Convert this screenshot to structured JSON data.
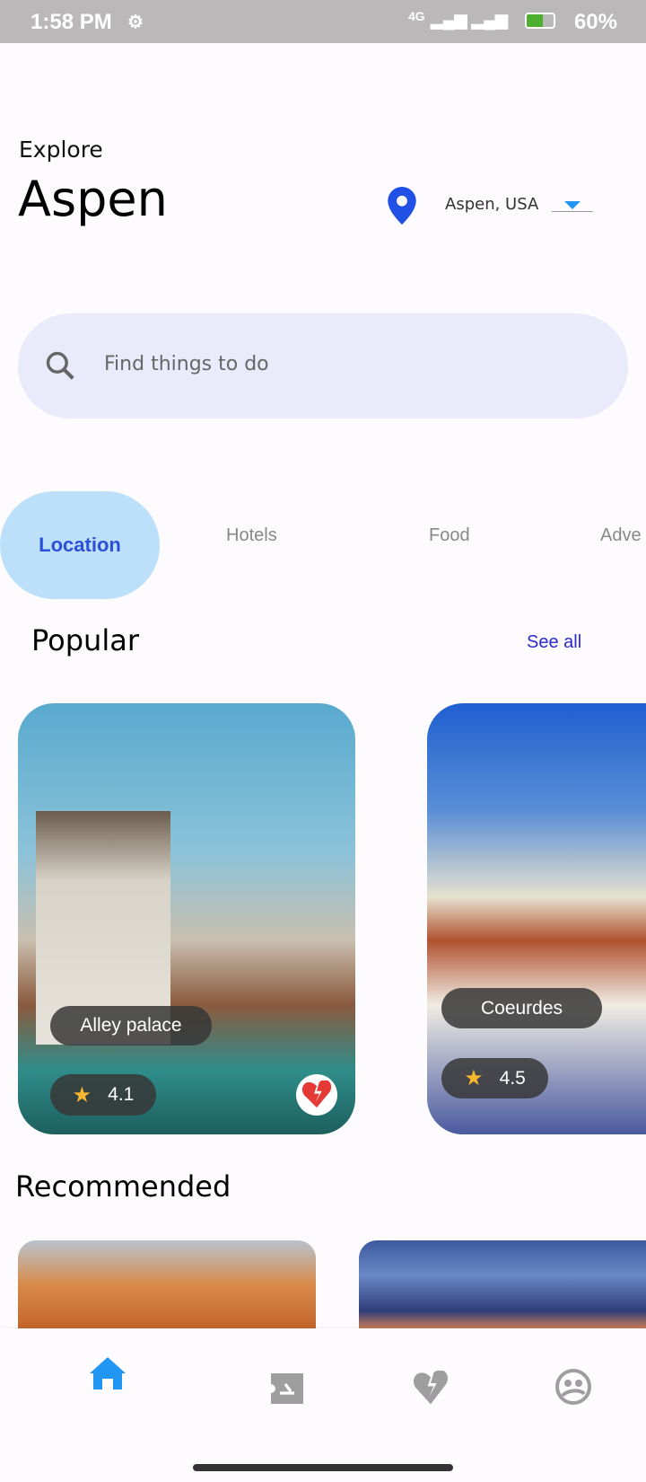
{
  "status_bar": {
    "time": "1:58 PM",
    "battery": "60%",
    "network": "4G"
  },
  "header": {
    "subtitle": "Explore",
    "title": "Aspen",
    "location": "Aspen, USA"
  },
  "search": {
    "placeholder": "Find things to do"
  },
  "tabs": [
    {
      "label": "Location",
      "active": true
    },
    {
      "label": "Hotels"
    },
    {
      "label": "Food"
    },
    {
      "label": "Adve"
    }
  ],
  "popular": {
    "title": "Popular",
    "see_all": "See all",
    "cards": [
      {
        "name": "Alley palace",
        "rating": "4.1"
      },
      {
        "name": "Coeurdes",
        "rating": "4.5"
      }
    ]
  },
  "recommended": {
    "title": "Recommended"
  },
  "nav": {
    "items": [
      "home-icon",
      "ticket-icon",
      "heart-broken-icon",
      "face-icon"
    ],
    "active_color": "#2196f3",
    "inactive_color": "#9e9e9e"
  },
  "colors": {
    "accent": "#2a4fd9",
    "tab_active_bg": "#bde0fa",
    "search_bg": "#e9ebfb"
  }
}
